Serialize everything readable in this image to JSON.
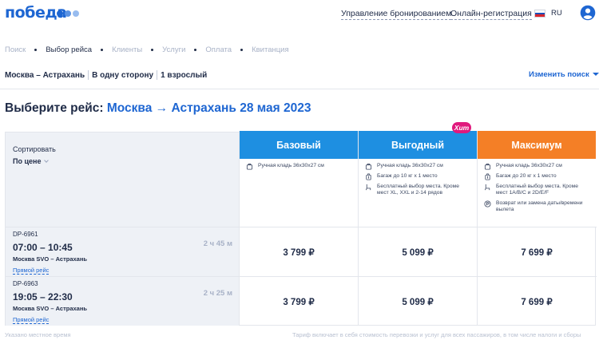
{
  "header": {
    "logo_text": "победа",
    "manage_booking": "Управление бронированием",
    "online_checkin": "Онлайн-регистрация",
    "language": "RU"
  },
  "breadcrumbs": [
    {
      "label": "Поиск",
      "active": false
    },
    {
      "label": "Выбор рейса",
      "active": true
    },
    {
      "label": "Клиенты",
      "active": false
    },
    {
      "label": "Услуги",
      "active": false
    },
    {
      "label": "Оплата",
      "active": false
    },
    {
      "label": "Квитанция",
      "active": false
    }
  ],
  "search_summary": {
    "route": "Москва – Астрахань",
    "trip_type": "В одну сторону",
    "passengers": "1 взрослый",
    "change_label": "Изменить поиск"
  },
  "title": {
    "prefix": "Выберите рейс:",
    "from": "Москва",
    "arrow": "→",
    "to": "Астрахань",
    "date": "28 мая 2023"
  },
  "sort": {
    "label": "Сортировать",
    "value": "По цене"
  },
  "tariffs": [
    {
      "name": "Базовый",
      "color": "#1e8fe1",
      "features": [
        {
          "icon": "bag-icon",
          "text": "Ручная кладь 36x30x27 см"
        }
      ]
    },
    {
      "name": "Выгодный",
      "color": "#1e8fe1",
      "badge": "Хит",
      "features": [
        {
          "icon": "bag-icon",
          "text": "Ручная кладь 36x30x27 см"
        },
        {
          "icon": "luggage-icon",
          "text": "Багаж до 10 кг х 1 место"
        },
        {
          "icon": "seat-icon",
          "text": "Бесплатный выбор места. Кроме мест XL, XXL и 2-14 рядов"
        }
      ]
    },
    {
      "name": "Максимум",
      "color": "#f47f26",
      "features": [
        {
          "icon": "bag-icon",
          "text": "Ручная кладь 36x30x27 см"
        },
        {
          "icon": "luggage-icon",
          "text": "Багаж до 20 кг х 1 место"
        },
        {
          "icon": "seat-icon",
          "text": "Бесплатный выбор места. Кроме мест 1A/B/C и 2D/E/F"
        },
        {
          "icon": "refund-icon",
          "text": "Возврат или замена даты/времени вылета"
        }
      ]
    }
  ],
  "flights": [
    {
      "number": "DP-6961",
      "times": "07:00 – 10:45",
      "duration": "2 ч 45 м",
      "cities": "Москва SVO – Астрахань",
      "type": "Прямой рейс",
      "prices": [
        "3 799 ₽",
        "5 099 ₽",
        "7 699 ₽"
      ]
    },
    {
      "number": "DP-6963",
      "times": "19:05 – 22:30",
      "duration": "2 ч 25 м",
      "cities": "Москва SVO – Астрахань",
      "type": "Прямой рейс",
      "prices": [
        "3 799 ₽",
        "5 099 ₽",
        "7 699 ₽"
      ]
    }
  ],
  "footer": {
    "left": "Указано местное время",
    "right": "Тариф включает в себя стоимость перевозки и услуг для всех пассажиров, в том числе налоги и сборы"
  }
}
